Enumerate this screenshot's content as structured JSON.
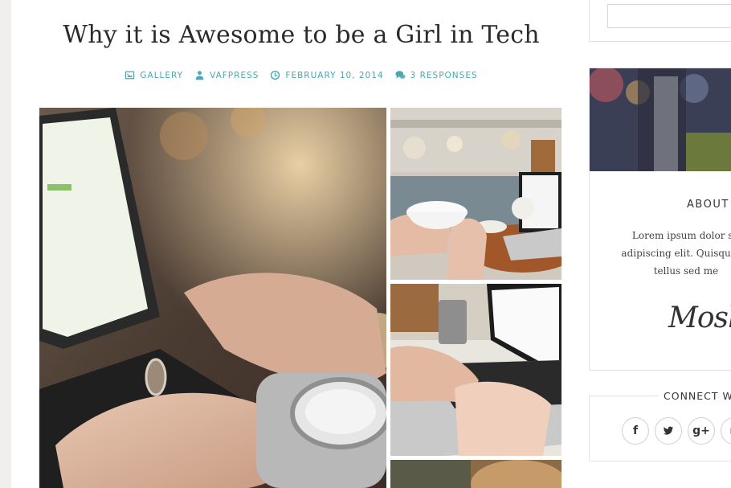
{
  "post": {
    "title": "Why it is Awesome to be a Girl in Tech",
    "meta": {
      "format": "GALLERY",
      "author": "VAFPRESS",
      "date": "FEBRUARY 10, 2014",
      "responses": "3 RESPONSES"
    },
    "gallery": {
      "images": [
        {
          "name": "hands-typing-laptop-watch",
          "icon": "photo"
        },
        {
          "name": "coffee-cup-cafe",
          "icon": "photo"
        },
        {
          "name": "typing-laptop-desk",
          "icon": "photo"
        },
        {
          "name": "partial-image",
          "icon": "photo"
        }
      ]
    }
  },
  "sidebar": {
    "search": {
      "placeholder": ""
    },
    "about": {
      "title": "ABOUT",
      "text_lines": [
        "Lorem ipsum dolor sit",
        "adipiscing elit. Quisque ve",
        "tellus sed me"
      ],
      "signature": "Mosh"
    },
    "connect": {
      "title": "CONNECT W",
      "buttons": [
        {
          "icon": "facebook-icon",
          "glyph": "f"
        },
        {
          "icon": "twitter-icon",
          "glyph": ""
        },
        {
          "icon": "google-plus-icon",
          "glyph": "g+"
        },
        {
          "icon": "more-icon",
          "glyph": ""
        }
      ]
    }
  },
  "colors": {
    "accent": "#4aa7b4",
    "title_text": "#2b2b2b",
    "page_bg": "#f1efec"
  }
}
